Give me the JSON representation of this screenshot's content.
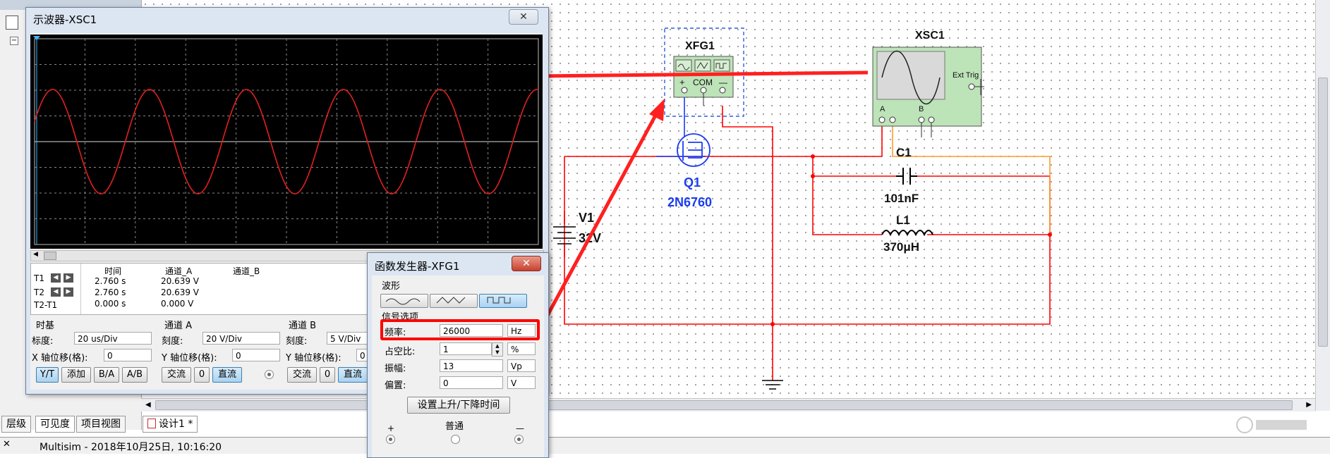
{
  "schematic": {
    "xfg1_ref": "XFG1",
    "xfg1_com": "COM",
    "xfg1_plus": "+",
    "xfg1_minus": "—",
    "xsc1_ref": "XSC1",
    "xsc1_ext_trig": "Ext Trig",
    "xsc1_a": "A",
    "xsc1_b": "B",
    "q1_ref": "Q1",
    "q1_model": "2N6760",
    "c1_ref": "C1",
    "c1_value": "101nF",
    "l1_ref": "L1",
    "l1_value": "370μH",
    "v1_ref": "V1",
    "v1_value": "32V"
  },
  "oscilloscope": {
    "title": "示波器-XSC1",
    "close_label": "✕",
    "headers": {
      "time": "时间",
      "channel_a": "通道_A",
      "channel_b": "通道_B"
    },
    "rows": [
      {
        "label": "T1",
        "time": "2.760 s",
        "a": "20.639 V",
        "b": ""
      },
      {
        "label": "T2",
        "time": "2.760 s",
        "a": "20.639 V",
        "b": ""
      },
      {
        "label": "T2-T1",
        "time": "0.000 s",
        "a": "0.000 V",
        "b": ""
      }
    ],
    "timebase": {
      "title": "时基",
      "scale_label": "标度:",
      "scale_value": "20 us/Div",
      "xpos_label": "X 轴位移(格):",
      "xpos_value": "0"
    },
    "channel_a": {
      "title": "通道 A",
      "scale_label": "刻度:",
      "scale_value": "20  V/Div",
      "ypos_label": "Y 轴位移(格):",
      "ypos_value": "0"
    },
    "channel_b": {
      "title": "通道 B",
      "scale_label": "刻度:",
      "scale_value": "5  V/Div",
      "ypos_label": "Y 轴位移(格):",
      "ypos_value": "0"
    },
    "buttons": {
      "yt": "Y/T",
      "add": "添加",
      "ba": "B/A",
      "ab": "A/B",
      "ac": "交流",
      "zero": "0",
      "dc": "直流"
    },
    "trace_color": "#e02020"
  },
  "function_generator": {
    "title": "函数发生器-XFG1",
    "close_label": "✕",
    "waveform_label": "波形",
    "signal_options_label": "信号选项",
    "frequency": {
      "label": "频率:",
      "value": "26000",
      "unit": "Hz"
    },
    "duty_cycle": {
      "label": "占空比:",
      "value": "1",
      "unit": "%"
    },
    "amplitude": {
      "label": "振幅:",
      "value": "13",
      "unit": "Vp"
    },
    "offset": {
      "label": "偏置:",
      "value": "0",
      "unit": "V"
    },
    "rise_fall_button": "设置上升/下降时间",
    "plus": "+",
    "common": "普通",
    "minus": "—"
  },
  "left_tabs": [
    "层级",
    "可见度",
    "项目视图"
  ],
  "design_tab": "设计1 *",
  "status_text": "Multisim  -  2018年10月25日, 10:16:20",
  "accent_colors": {
    "annotation_arrow": "#ff2020",
    "highlight_box": "#ff0000",
    "wire_red": "#ff0000",
    "wire_orange": "#ff9a2e",
    "wire_blue": "#1a3cf0",
    "label_blue": "#1a3cf0"
  }
}
